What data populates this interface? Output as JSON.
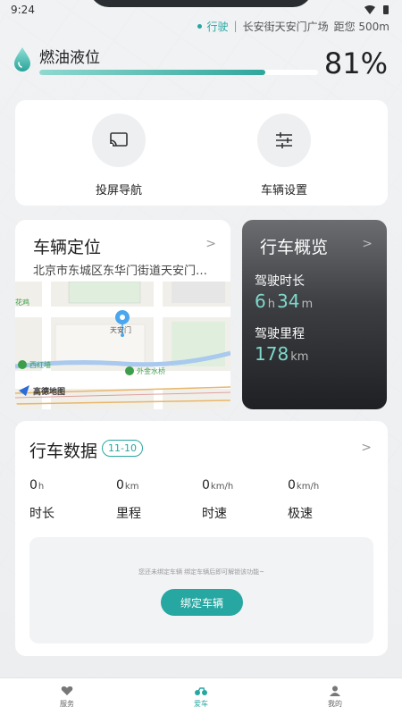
{
  "status_bar": {
    "time": "9:24"
  },
  "drive": {
    "mode": "行驶",
    "location": "长安街天安门广场",
    "distance": "距您 500m"
  },
  "fuel": {
    "label": "燃油液位",
    "percent_text": "81%",
    "level": 0.81
  },
  "shortcuts": [
    {
      "label": "投屏导航",
      "icon": "cast-icon"
    },
    {
      "label": "车辆设置",
      "icon": "sliders-icon"
    }
  ],
  "location_card": {
    "title": "车辆定位",
    "address": "北京市东城区东华门街道天安门…",
    "map": {
      "places": [
        "天安门",
        "西红墙",
        "外金水桥",
        "花鸡"
      ],
      "logo_text": "高德地图"
    }
  },
  "overview": {
    "title": "行车概览",
    "duration_label": "驾驶时长",
    "hours": "6",
    "hours_unit": "h",
    "minutes": "34",
    "minutes_unit": "m",
    "mileage_label": "驾驶里程",
    "mileage": "178",
    "mileage_unit": "km"
  },
  "driving_data": {
    "title": "行车数据",
    "date": "11-10",
    "stats": [
      {
        "value": "0",
        "unit": "h",
        "label": "时长"
      },
      {
        "value": "0",
        "unit": "km",
        "label": "里程"
      },
      {
        "value": "0",
        "unit": "km/h",
        "label": "时速"
      },
      {
        "value": "0",
        "unit": "km/h",
        "label": "极速"
      }
    ],
    "bind_tip": "您还未绑定车辆 绑定车辆后即可解锁该功能~",
    "bind_button": "绑定车辆"
  },
  "tabs": [
    {
      "label": "服务",
      "icon": "service-icon",
      "active": false
    },
    {
      "label": "爱车",
      "icon": "motorcycle-icon",
      "active": true
    },
    {
      "label": "我的",
      "icon": "user-icon",
      "active": false
    }
  ],
  "colors": {
    "accent": "#27a7a2",
    "overview_value": "#7fd8cc"
  }
}
